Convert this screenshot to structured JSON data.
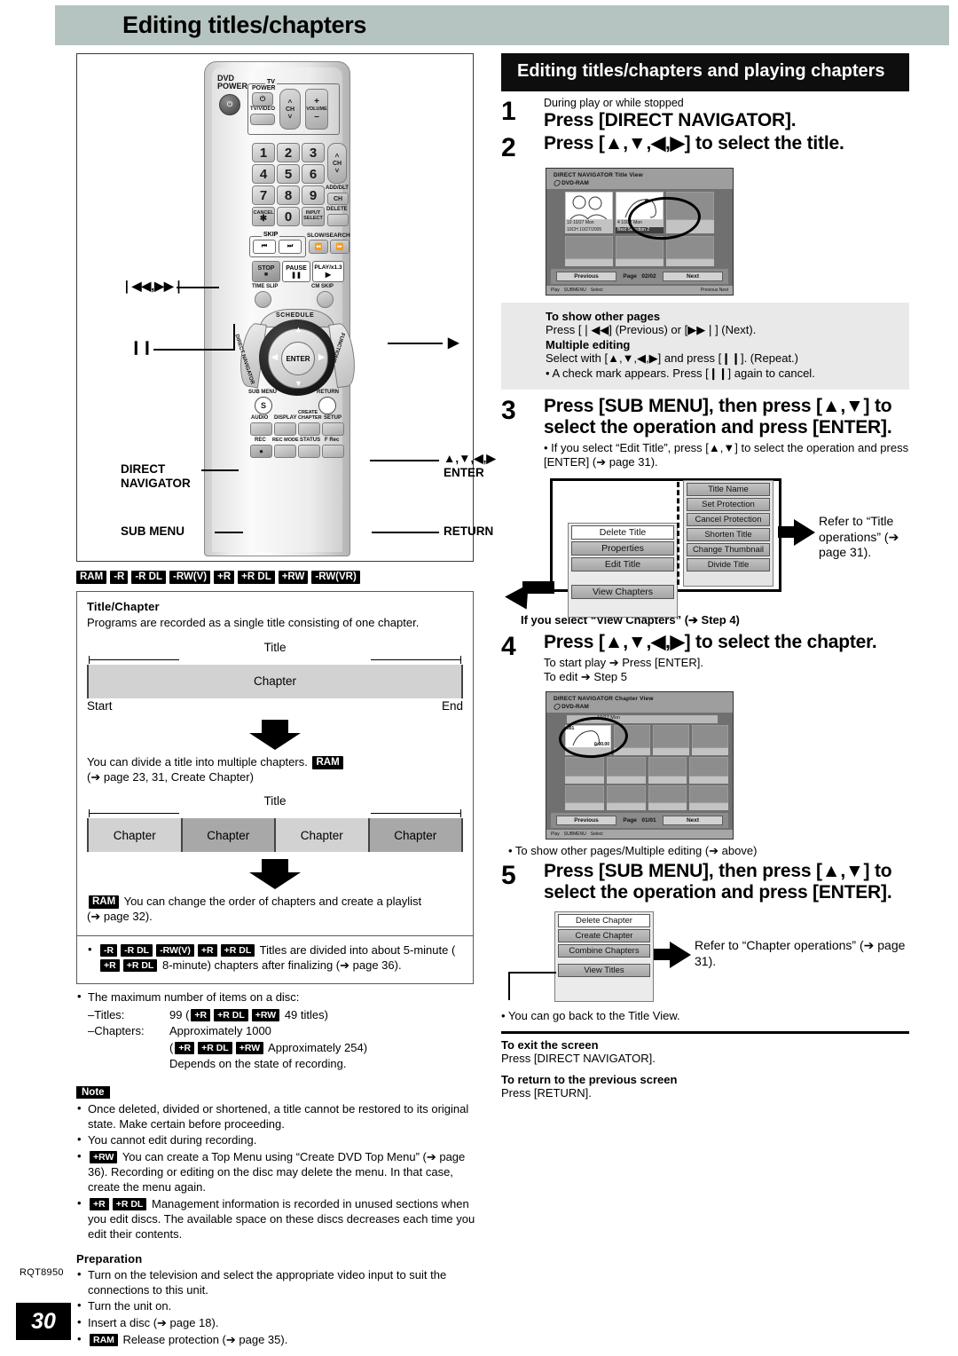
{
  "header": {
    "title": "Editing titles/chapters"
  },
  "remote": {
    "dvd_power": "DVD\nPOWER",
    "tv_group": "TV",
    "tv_power": "POWER",
    "tv_video": "TV/VIDEO",
    "ch": "CH",
    "volume": "VOLUME",
    "numbers": [
      "1",
      "2",
      "3",
      "4",
      "5",
      "6",
      "7",
      "8",
      "9",
      "0"
    ],
    "add_dlt": "ADD/DLT",
    "ch_small": "CH",
    "cancel": "CANCEL",
    "cancel_star": "✱",
    "input_select": "INPUT\nSELECT",
    "delete": "DELETE",
    "skip": "SKIP",
    "slow_search": "SLOW/SEARCH",
    "stop": "STOP",
    "pause": "PAUSE",
    "play": "PLAY/x1.3",
    "time_slip": "TIME SLIP",
    "cm_skip": "CM SKIP",
    "schedule": "SCHEDULE",
    "direct_navigator": "DIRECT NAVIGATOR",
    "functions": "FUNCTIONS",
    "enter": "ENTER",
    "sub_menu": "SUB MENU",
    "sub_menu_s": "S",
    "return": "RETURN",
    "audio": "AUDIO",
    "display": "DISPLAY",
    "create_chapter": "CREATE\nCHAPTER",
    "setup": "SETUP",
    "rec": "REC",
    "rec_mode": "REC MODE",
    "status": "STATUS",
    "f_rec": "F Rec",
    "callouts": {
      "skip": "❘◀◀,▶▶❘",
      "pause": "❙❙",
      "play": "▶",
      "direct_navigator": "DIRECT\nNAVIGATOR",
      "sub_menu": "SUB MENU",
      "cursor_enter": "▲,▼,◀,▶\nENTER",
      "return": "RETURN"
    }
  },
  "disc_badges": [
    "RAM",
    "-R",
    "-R DL",
    "-RW(V)",
    "+R",
    "+R DL",
    "+RW",
    "-RW(VR)"
  ],
  "title_chapter": {
    "heading": "Title/Chapter",
    "intro": "Programs are recorded as a single title consisting of one chapter.",
    "title_label": "Title",
    "chapter_label": "Chapter",
    "start_label": "Start",
    "end_label": "End",
    "divide_text": "You can divide a title into multiple chapters.",
    "divide_badge": "RAM",
    "divide_ref": "(➔ page 23, 31, Create Chapter)",
    "chapters": [
      "Chapter",
      "Chapter",
      "Chapter",
      "Chapter"
    ],
    "playlist_badge": "RAM",
    "playlist_text": "You can change the order of chapters and create a playlist",
    "playlist_ref": "(➔ page 32).",
    "finalize": {
      "badges": [
        "-R",
        "-R DL",
        "-RW(V)",
        "+R",
        "+R DL"
      ],
      "text_a": "Titles are divided into about 5-minute (",
      "badges_b": [
        "+R",
        "+R DL"
      ],
      "text_b": "8-minute) chapters after finalizing (➔ page 36)."
    },
    "max_items": {
      "lead": "The maximum number of items on a disc:",
      "titles_label": "–Titles:",
      "titles_value_pre": "99 (",
      "titles_badges": [
        "+R",
        "+R DL",
        "+RW"
      ],
      "titles_value_post": "49 titles)",
      "chapters_label": "–Chapters:",
      "chapters_value": "Approximately 1000",
      "chapters_badges": [
        "+R",
        "+R DL",
        "+RW"
      ],
      "chapters_paren_pre": "(",
      "chapters_paren_post": "Approximately 254)",
      "depends": "Depends on the state of recording."
    }
  },
  "note": {
    "tag": "Note",
    "items": [
      {
        "badges": [],
        "text": "Once deleted, divided or shortened, a title cannot be restored to its original state. Make certain before proceeding."
      },
      {
        "badges": [],
        "text": "You cannot edit during recording."
      },
      {
        "badges": [
          "+RW"
        ],
        "text": "You can create a Top Menu using “Create DVD Top Menu” (➔ page 36). Recording or editing on the disc may delete the menu. In that case, create the menu again."
      },
      {
        "badges": [
          "+R",
          "+R DL"
        ],
        "text": "Management information is recorded in unused sections when you edit discs. The available space on these discs decreases each time you edit their contents."
      }
    ]
  },
  "preparation": {
    "heading": "Preparation",
    "items": [
      {
        "badges": [],
        "text": "Turn on the television and select the appropriate video input to suit the connections to this unit."
      },
      {
        "badges": [],
        "text": "Turn the unit on."
      },
      {
        "badges": [],
        "text": "Insert a disc (➔ page 18)."
      },
      {
        "badges": [
          "RAM"
        ],
        "text": "Release protection (➔ page 35)."
      }
    ]
  },
  "right": {
    "block_title": "Editing titles/chapters and playing chapters",
    "step1": {
      "num": "1",
      "pre": "During play or while stopped",
      "main": "Press [DIRECT NAVIGATOR]."
    },
    "step2": {
      "num": "2",
      "main": "Press [▲,▼,◀,▶] to select the title."
    },
    "osd_title": {
      "line1": "DIRECT NAVIGATOR Title View",
      "line2": "DVD-RAM",
      "thumb1_cap": "10  10/27 Mon",
      "thumb1_cap2": "10CH 10/27/2005",
      "thumb2_cap": "4   10/27 Mon",
      "thumb2_cap2": "Best Selection 2",
      "previous": "Previous",
      "page_label": "Page",
      "page_value": "02/02",
      "next": "Next",
      "foot_play": "Play",
      "foot_submenu": "SUBMENU",
      "foot_select": "Select",
      "foot_prevnext": "Previous            Next"
    },
    "gray_box": {
      "h1": "To show other pages",
      "t1": "Press [❘◀◀] (Previous) or [▶▶❘] (Next).",
      "h2": "Multiple editing",
      "t2": "Select with [▲,▼,◀,▶] and press [❙❙]. (Repeat.)",
      "t3": "• A check mark appears. Press [❙❙] again to cancel."
    },
    "step3": {
      "num": "3",
      "main": "Press [SUB MENU], then press [▲,▼] to select the operation and press [ENTER].",
      "sub": "• If you select “Edit Title”, press [▲,▼] to select the operation and press [ENTER] (➔ page 31)."
    },
    "title_menu": {
      "primary": [
        "Delete Title",
        "Properties",
        "Edit Title",
        "View Chapters"
      ],
      "secondary": [
        "Title Name",
        "Set Protection",
        "Cancel Protection",
        "Shorten Title",
        "Change Thumbnail",
        "Divide Title"
      ],
      "refer": "Refer to “Title operations” (➔ page 31)."
    },
    "view_chapters_note": "If you select “View Chapters” (➔ Step 4)",
    "step4": {
      "num": "4",
      "main": "Press [▲,▼,◀,▶] to select the chapter.",
      "sub1": "To start play ➔ Press [ENTER].",
      "sub2": "To edit ➔ Step 5"
    },
    "osd_chapter": {
      "line1": "DIRECT NAVIGATOR Chapter View",
      "line2": "DVD-RAM",
      "strip": "10/27 Mon",
      "chap_num": "001",
      "chap_time": "0:00.00",
      "previous": "Previous",
      "page_label": "Page",
      "page_value": "01/01",
      "next": "Next",
      "foot_play": "Play",
      "foot_submenu": "SUBMENU",
      "foot_select": "Select"
    },
    "step4_note": "• To show other pages/Multiple editing (➔ above)",
    "step5": {
      "num": "5",
      "main": "Press [SUB MENU], then press [▲,▼] to select the operation and press [ENTER]."
    },
    "chapter_menu": {
      "items": [
        "Delete Chapter",
        "Create Chapter",
        "Combine Chapters",
        "View Titles"
      ],
      "refer": "Refer to “Chapter operations” (➔ page 31)."
    },
    "back_note": "• You can go back to the Title View.",
    "exit": {
      "h": "To exit the screen",
      "t": "Press [DIRECT NAVIGATOR]."
    },
    "back": {
      "h": "To return to the previous screen",
      "t": "Press [RETURN]."
    }
  },
  "footer": {
    "rqt": "RQT8950",
    "page": "30"
  }
}
